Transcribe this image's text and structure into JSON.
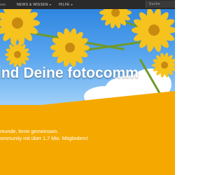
{
  "nav": {
    "items": [
      {
        "label": "NEWS & WISSEN"
      },
      {
        "label": "HILFE"
      }
    ],
    "caret_icon": "chevron-down-icon",
    "search_placeholder": "Suche"
  },
  "hero": {
    "title": "ind Deine fotocomm",
    "colors": {
      "sky": "#2f86e0",
      "petal": "#f6c21e",
      "band": "#f5a900"
    }
  },
  "tagline": {
    "line1": "reunde, lerne gemeinsam.",
    "line2": "ommunity mit über 1,7 Mio. Mitgliedern!"
  }
}
